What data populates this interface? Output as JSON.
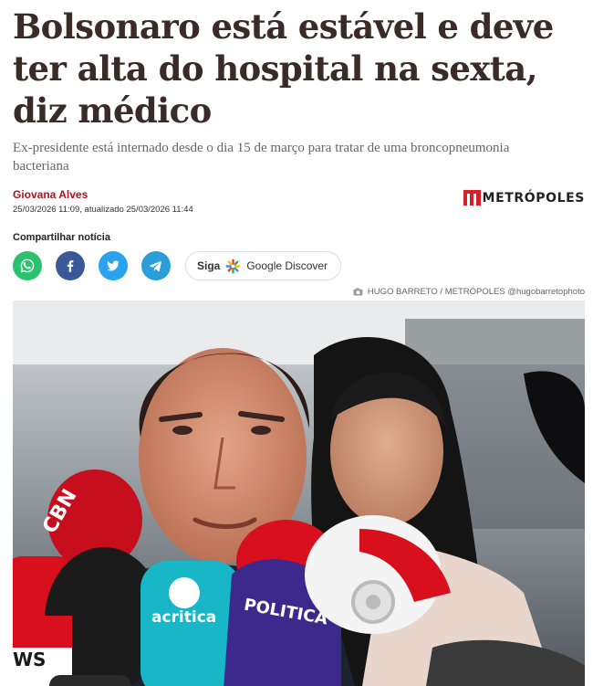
{
  "article": {
    "headline": "Bolsonaro está estável e deve ter alta do hospital na sexta, diz médico",
    "subheadline": "Ex-presidente está internado desde o dia 15 de março para tratar de uma broncopneumonia bacteriana",
    "author": "Giovana Alves",
    "dates": "25/03/2026 11:09, atualizado 25/03/2026 11:44",
    "brand": "METRÓPOLES"
  },
  "share": {
    "label": "Compartilhar notícia",
    "buttons": [
      {
        "name": "whatsapp",
        "color": "#2ac26e"
      },
      {
        "name": "facebook",
        "color": "#3b5998"
      },
      {
        "name": "twitter",
        "color": "#2aa3ef"
      },
      {
        "name": "telegram",
        "color": "#2a9ed8"
      }
    ],
    "discover_siga": "Siga",
    "discover_label": "Google Discover"
  },
  "photo": {
    "credit": "HUGO BARRETO / METRÓPOLES @hugobarretophoto",
    "mic_labels": {
      "cbn": "CBN",
      "acritica": "acritica",
      "politica": "POLITICA",
      "news": "WS"
    }
  },
  "colors": {
    "headline": "#3a2a28",
    "author": "#b3121d",
    "brand_red": "#d61f26"
  }
}
